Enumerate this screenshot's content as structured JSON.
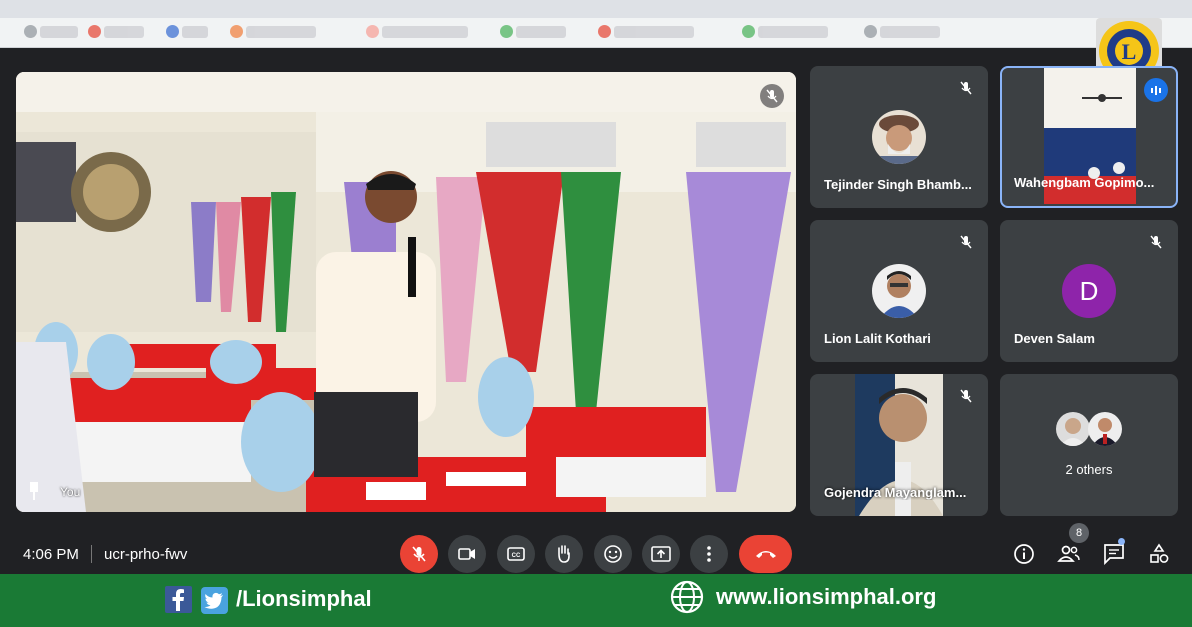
{
  "meeting": {
    "time": "4:06 PM",
    "code": "ucr-prho-fwv"
  },
  "main_tile": {
    "label": "You"
  },
  "participants": [
    {
      "name": "Tejinder Singh Bhamb...",
      "muted": true
    },
    {
      "name": "Wahengbam Gopimo...",
      "speaking": true
    },
    {
      "name": "Lion Lalit Kothari",
      "muted": true
    },
    {
      "name": "Deven Salam",
      "muted": true,
      "initial": "D"
    },
    {
      "name": "Gojendra Mayanglam...",
      "muted": true
    },
    {
      "name": "2 others"
    }
  ],
  "people_count": "8",
  "footer": {
    "handle": "/Lionsimphal",
    "website": "www.lionsimphal.org"
  },
  "colors": {
    "accent_red": "#ea4335",
    "speaking_blue": "#8ab4f8",
    "banner_green": "#1a7a35",
    "deven_avatar": "#8e24aa"
  }
}
